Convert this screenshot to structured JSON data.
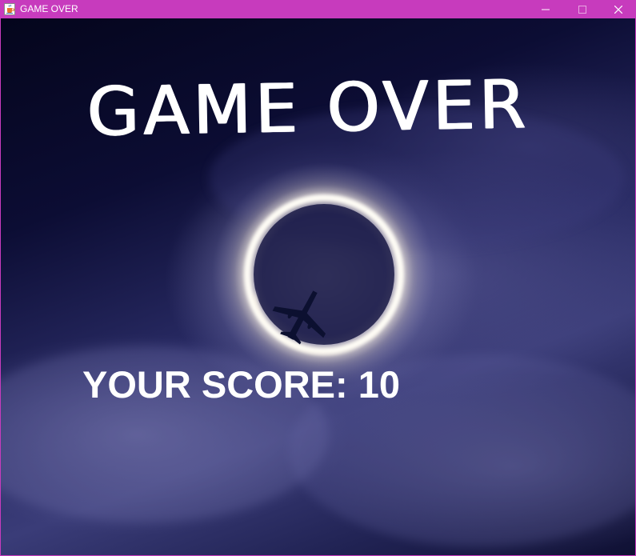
{
  "window": {
    "title": "GAME OVER",
    "title_bar_color": "#c73bbd"
  },
  "window_controls": {
    "minimize_icon": "minimize-icon",
    "maximize_icon": "maximize-icon",
    "close_icon": "close-icon"
  },
  "app_icon": "java-coffee-cup-icon",
  "game_over": {
    "title": "GAME OVER",
    "score_text": "YOUR SCORE: 10"
  },
  "background": {
    "description_icon": "eclipse-ring-airplane-night-sky-image"
  }
}
